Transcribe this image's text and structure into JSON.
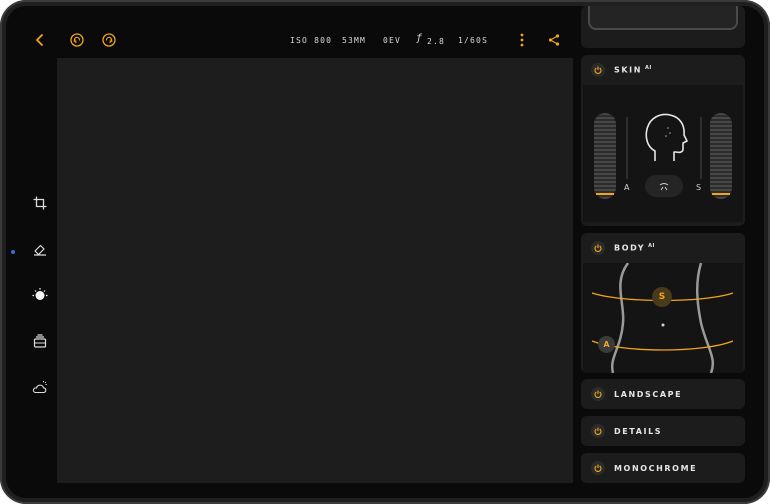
{
  "colors": {
    "accent": "#f2a51a",
    "canvas": "#1d1d1d",
    "panel": "#1c1c1c"
  },
  "toolbar": {
    "icons": [
      "chevron-left-icon",
      "undo-icon",
      "redo-icon",
      "more-vertical-icon",
      "share-icon"
    ],
    "exif": {
      "iso": "ISO 800",
      "focal": "53MM",
      "ev": "0EV",
      "aperture_symbol": "ƒ",
      "aperture": "2.8",
      "shutter": "1/60S"
    }
  },
  "left_tools": [
    "crop-icon",
    "eraser-icon",
    "light-icon",
    "layers-icon",
    "weather-icon"
  ],
  "panel": {
    "skin": {
      "label": "SKIN",
      "badge": "AI",
      "left_label": "A",
      "right_label": "S",
      "left_level": 0.1,
      "right_level": 0.1
    },
    "body": {
      "label": "BODY",
      "badge": "AI",
      "handle_s": "S",
      "handle_a": "A"
    },
    "landscape": {
      "label": "LANDSCAPE"
    },
    "details": {
      "label": "DETAILS"
    },
    "monochrome": {
      "label": "MONOCHROME"
    }
  }
}
